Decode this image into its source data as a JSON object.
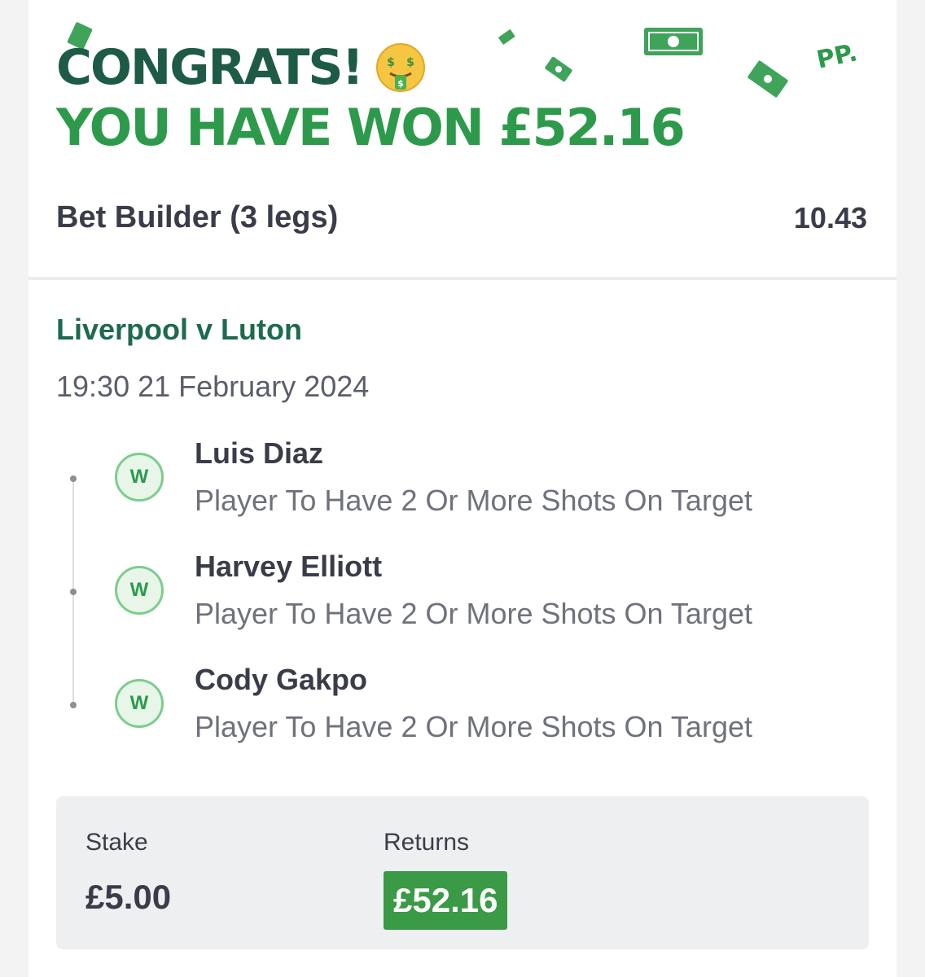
{
  "header": {
    "congrats": "CONGRATS!",
    "won_text": "YOU HAVE WON £52.16",
    "logo": "PP.",
    "emoji_icon": "money-mouth-face-icon"
  },
  "bet": {
    "title": "Bet Builder (3 legs)",
    "odds": "10.43"
  },
  "event": {
    "name": "Liverpool v Luton",
    "datetime": "19:30 21 February 2024"
  },
  "legs": [
    {
      "result": "W",
      "player": "Luis Diaz",
      "market": "Player To Have 2 Or More Shots On Target"
    },
    {
      "result": "W",
      "player": "Harvey Elliott",
      "market": "Player To Have 2 Or More Shots On Target"
    },
    {
      "result": "W",
      "player": "Cody Gakpo",
      "market": "Player To Have 2 Or More Shots On Target"
    }
  ],
  "summary": {
    "stake_label": "Stake",
    "stake_value": "£5.00",
    "returns_label": "Returns",
    "returns_value": "£52.16"
  },
  "colors": {
    "brand_dark_green": "#1e5b47",
    "brand_green": "#2d9a4b",
    "returns_bg": "#3a9a45",
    "text_dark": "#3a3d49"
  }
}
